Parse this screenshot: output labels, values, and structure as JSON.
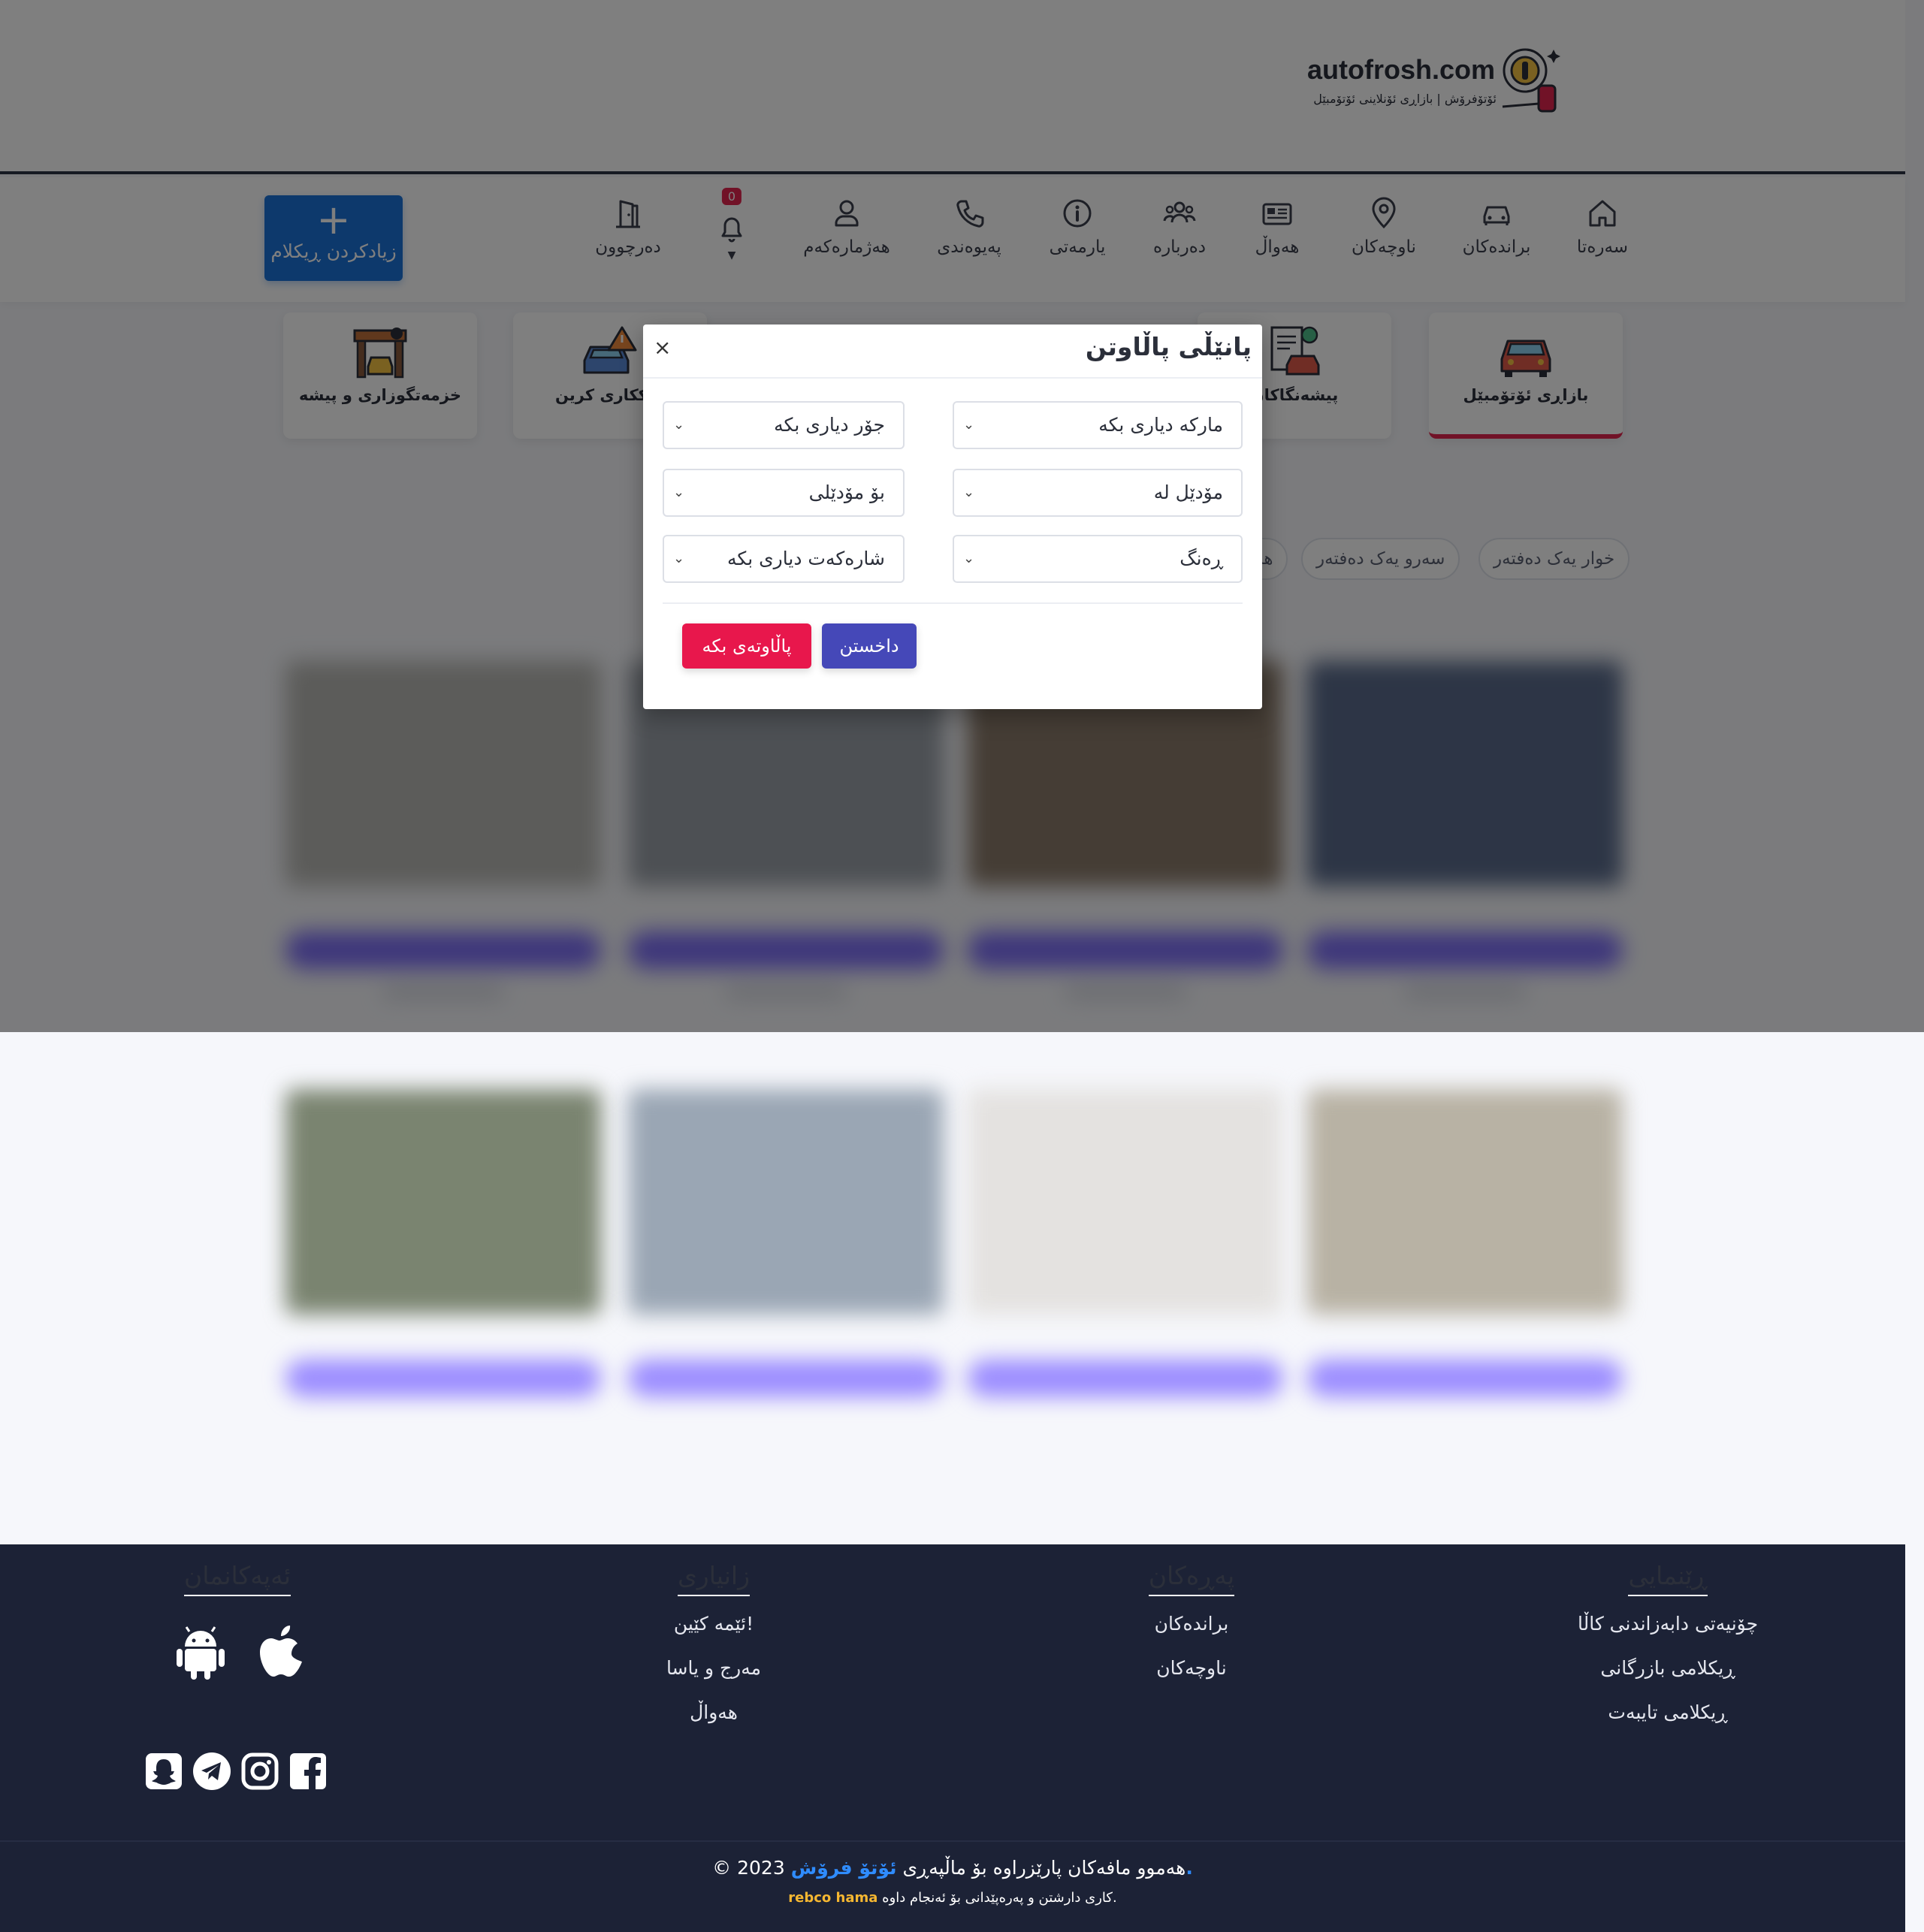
{
  "header": {
    "logo_text": "autofrosh.com",
    "logo_subtitle": "ئۆتۆفرۆش | بازاڕی ئۆنلاینی ئۆتۆمبێل"
  },
  "nav": {
    "items": [
      {
        "label": "سەرەتا",
        "icon": "home-icon"
      },
      {
        "label": "براندەکان",
        "icon": "car-icon"
      },
      {
        "label": "ناوچەکان",
        "icon": "location-pin-icon"
      },
      {
        "label": "هەواڵ",
        "icon": "newspaper-icon"
      },
      {
        "label": "دەربارە",
        "icon": "users-icon"
      },
      {
        "label": "یارمەتی",
        "icon": "info-icon"
      },
      {
        "label": "پەیوەندی",
        "icon": "phone-icon"
      },
      {
        "label": "هەژمارەکەم",
        "icon": "user-icon"
      },
      {
        "label": "دەرچوون",
        "icon": "exit-door-icon"
      }
    ],
    "notification_count": "0",
    "add_ad": {
      "plus": "+",
      "label": "زیادکردن ڕیکلام"
    }
  },
  "categories": [
    {
      "label": "بازاڕی ئۆتۆمبێل",
      "active": true
    },
    {
      "label": "پیشەنگاکان",
      "active": false
    },
    {
      "label": "چاککاری کرین",
      "active": false
    },
    {
      "label": "خزمەتگوزاری و پیشە",
      "active": false
    }
  ],
  "chips": [
    "خوار یەک دەفتەر",
    "سەرو یەک دەفتەر",
    "هە"
  ],
  "modal": {
    "title": "پانێڵی پاڵاوتن",
    "close": "×",
    "selects": {
      "brand": "مارکە دیاری بکە",
      "type": "جۆر دیاری بکە",
      "model_from": "مۆدێل لە",
      "model_to": "بۆ مۆدێلی",
      "color": "ڕەنگ",
      "city": "شارەکەت دیاری بکە"
    },
    "buttons": {
      "close": "داخستن",
      "clear": "پاڵاوتەی بکە"
    }
  },
  "footer": {
    "guide": {
      "title": "ڕێنمایی",
      "links": [
        "چۆنیەتی دابەزاندنی کاڵا",
        "ڕیکلامی بازرگانی",
        "ڕیکلامی تایبەت"
      ]
    },
    "pages": {
      "title": "پەڕەکان",
      "links": [
        "براندەکان",
        "ناوچەکان"
      ]
    },
    "info": {
      "title": "زانیاری",
      "links": [
        "ئێمە کێین!",
        "مەرج و یاسا",
        "هەواڵ"
      ]
    },
    "apps": {
      "title": "ئەپەکانمان"
    },
    "copyright": {
      "prefix": "© 2023 هەموو مافەکان پارێزراوە بۆ ماڵپەڕی",
      "brand": "ئۆتۆ فرۆش",
      "suffix": "."
    },
    "credit": {
      "author": "rebco hama",
      "text": "کاری دارشتن و پەرەپێدانی بۆ ئەنجام داوە."
    }
  },
  "colors": {
    "primary": "#1a72d9",
    "accent": "#e3254f",
    "close_button": "#4548b8",
    "clear_button": "#e8174c",
    "footer_bg": "#1c2236",
    "brand_link": "#2f8cff",
    "credit": "#f5b731"
  }
}
